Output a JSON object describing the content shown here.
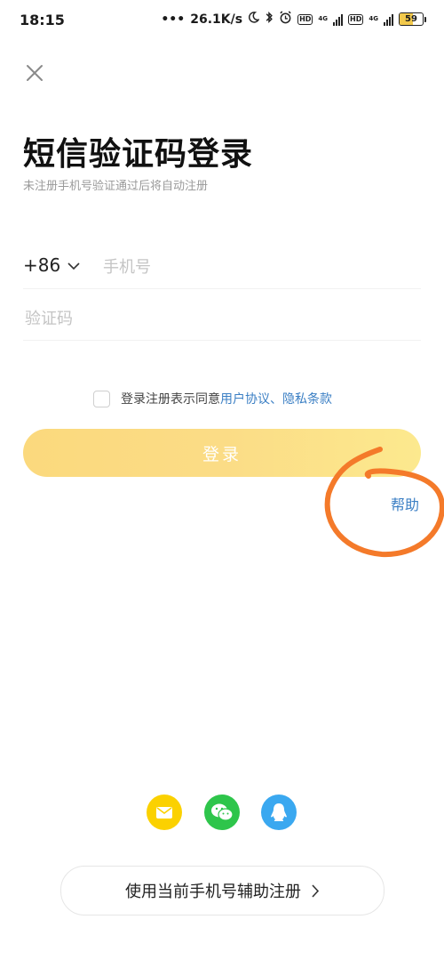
{
  "status_bar": {
    "time": "18:15",
    "network_speed": "26.1K/s",
    "network_type_1": "4G",
    "network_type_2": "4G",
    "hd_label": "HD",
    "battery_level": 59
  },
  "header": {
    "close_icon": "close-icon",
    "title": "短信验证码登录",
    "subtitle": "未注册手机号验证通过后将自动注册"
  },
  "form": {
    "country_code": "+86",
    "phone_placeholder": "手机号",
    "code_placeholder": "验证码"
  },
  "agreement": {
    "prefix": "登录注册表示同意",
    "user_agreement": "用户协议",
    "separator": "、",
    "privacy_policy": "隐私条款"
  },
  "login_button": "登录",
  "help_link": "帮助",
  "social_login": {
    "icons": [
      "mail-icon",
      "wechat-icon",
      "qq-icon"
    ],
    "colors": {
      "mail": "#fbd100",
      "wechat": "#2ec54b",
      "qq": "#3aa8f0"
    }
  },
  "assist_register": {
    "label": "使用当前手机号辅助注册"
  },
  "colors": {
    "accent_link": "#3b7fc4",
    "login_button": "#fbd97d",
    "annotation": "#f47a2a"
  }
}
